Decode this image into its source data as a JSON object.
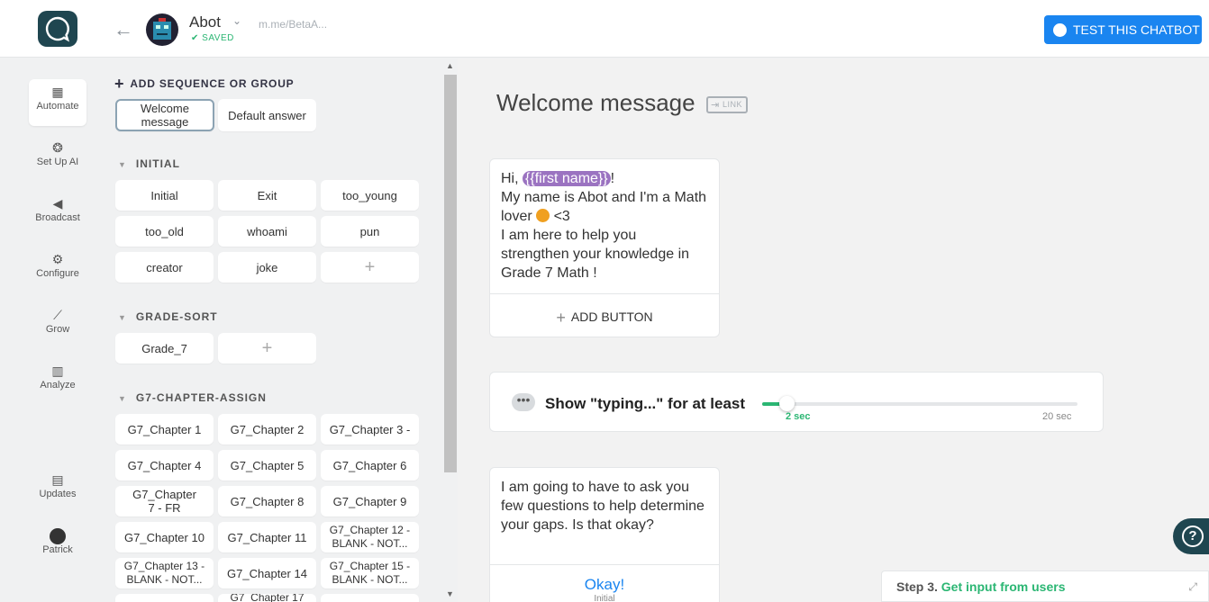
{
  "header": {
    "bot_name": "Abot",
    "saved": "SAVED",
    "link": "m.me/BetaA...",
    "test_button": "TEST THIS CHATBOT"
  },
  "nav": [
    {
      "label": "Automate",
      "icon": "robot-icon"
    },
    {
      "label": "Set Up AI",
      "icon": "brain-icon"
    },
    {
      "label": "Broadcast",
      "icon": "megaphone-icon"
    },
    {
      "label": "Configure",
      "icon": "gear-icon"
    },
    {
      "label": "Grow",
      "icon": "trend-icon"
    },
    {
      "label": "Analyze",
      "icon": "bar-chart-icon"
    },
    {
      "label": "Updates",
      "icon": "news-icon"
    },
    {
      "label": "Patrick",
      "icon": "avatar-icon"
    }
  ],
  "sidebar": {
    "add_sequence": "ADD SEQUENCE OR GROUP",
    "welcome": "Welcome message",
    "default_answer": "Default answer",
    "groups": [
      {
        "name": "INITIAL",
        "blocks": [
          "Initial",
          "Exit",
          "too_young",
          "too_old",
          "whoami",
          "pun",
          "creator",
          "joke"
        ]
      },
      {
        "name": "GRADE-SORT",
        "blocks": [
          "Grade_7"
        ]
      },
      {
        "name": "G7-CHAPTER-ASSIGN",
        "blocks": [
          "G7_Chapter 1",
          "G7_Chapter 2",
          "G7_Chapter 3 -",
          "G7_Chapter 4",
          "G7_Chapter 5",
          "G7_Chapter 6",
          "G7_Chapter 7 - FR",
          "G7_Chapter 8",
          "G7_Chapter 9",
          "G7_Chapter 10",
          "G7_Chapter 11",
          "G7_Chapter 12 - BLANK - NOT...",
          "G7_Chapter 13 - BLANK - NOT...",
          "G7_Chapter 14",
          "G7_Chapter 15 - BLANK - NOT...",
          "G7_Chapter 17"
        ]
      }
    ]
  },
  "editor": {
    "title": "Welcome message",
    "link_label": "LINK",
    "msg1": {
      "hi": "Hi, ",
      "tag": "{{first name}}",
      "excl": "!",
      "line2": "My name is Abot and I'm a Math lover",
      "line2b": " <3",
      "line3": "I am here to help you strengthen your knowledge in Grade 7 Math !"
    },
    "add_button": "ADD BUTTON",
    "typing": {
      "label": "Show \"typing...\" for at least",
      "min": "2 sec",
      "max": "20 sec",
      "value": 2
    },
    "msg2": "I am going to have to ask you few questions to help determine your gaps. Is that okay?",
    "quick_reply": {
      "label": "Okay!",
      "target": "Initial"
    }
  },
  "step": {
    "num": "Step 3.",
    "desc": "Get input from users"
  }
}
